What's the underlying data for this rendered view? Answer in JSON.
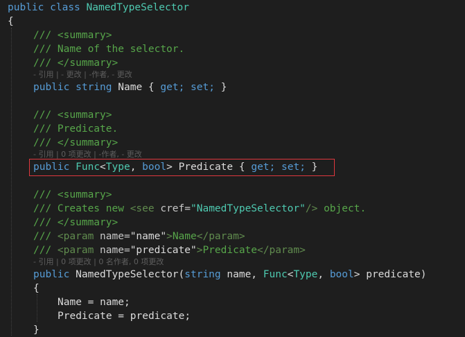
{
  "code": {
    "class_line": [
      "public",
      "class",
      "NamedTypeSelector"
    ],
    "brace_open": "{",
    "brace_close": "}",
    "name_doc": {
      "summary_open": "/// <summary>",
      "text": "/// Name of the selector.",
      "summary_close": "/// </summary>"
    },
    "name_lens": "- 引用 | - 更改 | -作者, - 更改",
    "name_prop": [
      "public",
      "string",
      "Name",
      "{",
      "get;",
      "set;",
      "}"
    ],
    "pred_doc": {
      "summary_open": "/// <summary>",
      "text": "/// Predicate.",
      "summary_close": "/// </summary>"
    },
    "pred_lens": "- 引用 | 0 项更改 | -作者, - 更改",
    "pred_prop": [
      "public",
      "Func",
      "<",
      "Type",
      ",",
      "bool",
      ">",
      "Predicate",
      "{",
      "get;",
      "set;",
      "}"
    ],
    "ctor_doc": {
      "summary_open": "/// <summary>",
      "creates_prefix": "/// Creates new ",
      "see_tag_open": "<see ",
      "cref_attr": "cref=",
      "cref_value": "\"NamedTypeSelector\"",
      "see_tag_close": "/>",
      "creates_suffix": " object.",
      "summary_close": "/// </summary>",
      "param1_prefix": "/// ",
      "param1_open": "<param ",
      "param1_attr": "name=",
      "param1_value": "\"name\"",
      "param1_gt": ">",
      "param1_text": "Name",
      "param1_close": "</param>",
      "param2_prefix": "/// ",
      "param2_open": "<param ",
      "param2_attr": "name=",
      "param2_value": "\"predicate\"",
      "param2_gt": ">",
      "param2_text": "Predicate",
      "param2_close": "</param>"
    },
    "ctor_lens": "- 引用 | 0 项更改 | 0 名作者, 0 项更改",
    "ctor_sig": [
      "public",
      "NamedTypeSelector",
      "(",
      "string",
      "name,",
      "Func",
      "<",
      "Type",
      ",",
      "bool",
      ">",
      "predicate",
      ")"
    ],
    "ctor_body": {
      "open": "{",
      "line1": "Name = name;",
      "line2": "Predicate = predicate;",
      "close": "}"
    }
  },
  "colors": {
    "background": "#1e1e1e",
    "keyword": "#569cd6",
    "type": "#4ec9b0",
    "comment": "#57a64a",
    "highlight_box": "#e0383e"
  }
}
